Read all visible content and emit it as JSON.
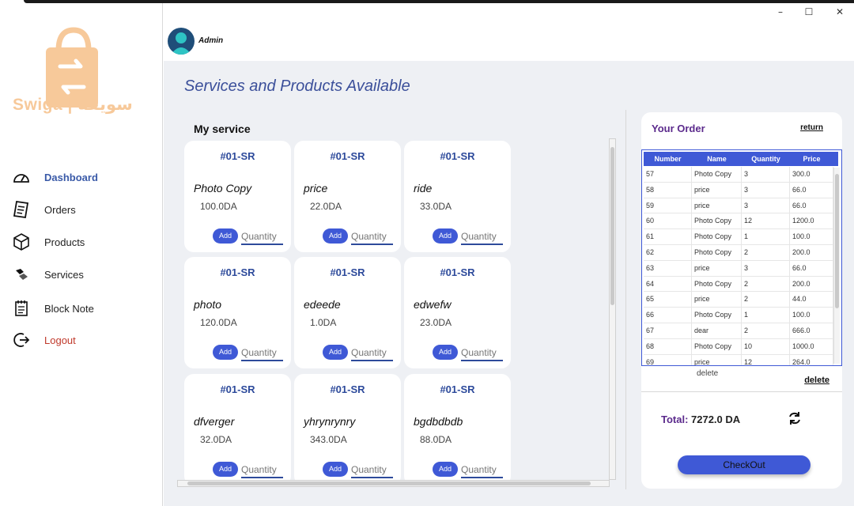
{
  "window": {
    "minimize": "–",
    "maximize": "☐",
    "close": "✕"
  },
  "brand": {
    "logo_text": "Swiga | سويقة",
    "logo_color": "#f7c99a"
  },
  "sidebar": {
    "items": [
      {
        "label": "Dashboard",
        "icon": "gauge-icon",
        "active": true
      },
      {
        "label": "Orders",
        "icon": "receipt-icon"
      },
      {
        "label": "Products",
        "icon": "box-icon"
      },
      {
        "label": "Services",
        "icon": "handshake-icon"
      },
      {
        "label": "Block Note",
        "icon": "notepad-icon"
      },
      {
        "label": "Logout",
        "icon": "logout-icon"
      }
    ]
  },
  "header": {
    "user": "Admin"
  },
  "main": {
    "title": "Services and Products Available",
    "section": "My service",
    "cards": [
      {
        "code": "#01-SR",
        "name": "Photo Copy",
        "price": "100.0DA",
        "add": "Add",
        "qty_placeholder": "Quantity"
      },
      {
        "code": "#01-SR",
        "name": "price",
        "price": "22.0DA",
        "add": "Add",
        "qty_placeholder": "Quantity"
      },
      {
        "code": "#01-SR",
        "name": "ride",
        "price": "33.0DA",
        "add": "Add",
        "qty_placeholder": "Quantity"
      },
      {
        "code": "#01-SR",
        "name": "photo",
        "price": "120.0DA",
        "add": "Add",
        "qty_placeholder": "Quantity"
      },
      {
        "code": "#01-SR",
        "name": "edeede",
        "price": "1.0DA",
        "add": "Add",
        "qty_placeholder": "Quantity"
      },
      {
        "code": "#01-SR",
        "name": "edwefw",
        "price": "23.0DA",
        "add": "Add",
        "qty_placeholder": "Quantity"
      },
      {
        "code": "#01-SR",
        "name": "dfverger",
        "price": "32.0DA",
        "add": "Add",
        "qty_placeholder": "Quantity"
      },
      {
        "code": "#01-SR",
        "name": "yhrynrynry",
        "price": "343.0DA",
        "add": "Add",
        "qty_placeholder": "Quantity"
      },
      {
        "code": "#01-SR",
        "name": "bgdbdbdb",
        "price": "88.0DA",
        "add": "Add",
        "qty_placeholder": "Quantity"
      }
    ]
  },
  "order": {
    "title": "Your Order",
    "return": "return",
    "columns": [
      "Number",
      "Name",
      "Quantity",
      "Price"
    ],
    "rows": [
      [
        "57",
        "Photo Copy",
        "3",
        "300.0"
      ],
      [
        "58",
        "price",
        "3",
        "66.0"
      ],
      [
        "59",
        "price",
        "3",
        "66.0"
      ],
      [
        "60",
        "Photo Copy",
        "12",
        "1200.0"
      ],
      [
        "61",
        "Photo Copy",
        "1",
        "100.0"
      ],
      [
        "62",
        "Photo Copy",
        "2",
        "200.0"
      ],
      [
        "63",
        "price",
        "3",
        "66.0"
      ],
      [
        "64",
        "Photo Copy",
        "2",
        "200.0"
      ],
      [
        "65",
        "price",
        "2",
        "44.0"
      ],
      [
        "66",
        "Photo Copy",
        "1",
        "100.0"
      ],
      [
        "67",
        "dear",
        "2",
        "666.0"
      ],
      [
        "68",
        "Photo Copy",
        "10",
        "1000.0"
      ],
      [
        "69",
        "price",
        "12",
        "264.0"
      ]
    ],
    "delete_small": "delete",
    "delete": "delete",
    "total_label": "Total:",
    "total_value": "7272.0 DA",
    "checkout": "CheckOut"
  },
  "colors": {
    "accent": "#3f59d6",
    "title": "#3b4f9a",
    "purple": "#5b2a8c",
    "logout": "#c0392b"
  }
}
